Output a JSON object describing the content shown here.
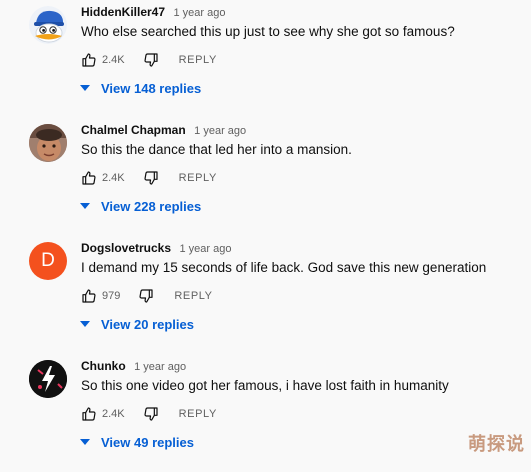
{
  "comments": [
    {
      "author": "HiddenKiller47",
      "time": "1 year ago",
      "text": "Who else searched this up just to see why she got so famous?",
      "likes": "2.4K",
      "reply_label": "REPLY",
      "replies_label": "View 148 replies",
      "avatar_icon": "cartoon-duck-avatar"
    },
    {
      "author": "Chalmel Chapman",
      "time": "1 year ago",
      "text": "So this the dance that led her into a mansion.",
      "likes": "2.4K",
      "reply_label": "REPLY",
      "replies_label": "View 228 replies",
      "avatar_icon": "child-face-avatar"
    },
    {
      "author": "Dogslovetrucks",
      "time": "1 year ago",
      "text": "I demand my 15 seconds of life back. God save this new generation",
      "likes": "979",
      "reply_label": "REPLY",
      "replies_label": "View 20 replies",
      "avatar_letter": "D",
      "avatar_color": "#f4511e"
    },
    {
      "author": "Chunko",
      "time": "1 year ago",
      "text": "So this one video got her famous, i have lost faith in humanity",
      "likes": "2.4K",
      "reply_label": "REPLY",
      "replies_label": "View 49 replies",
      "avatar_icon": "dark-logo-avatar"
    }
  ],
  "colors": {
    "link": "#065fd4",
    "secondary_text": "#606060",
    "background": "#f9f9f9"
  },
  "watermark": "萌探说"
}
